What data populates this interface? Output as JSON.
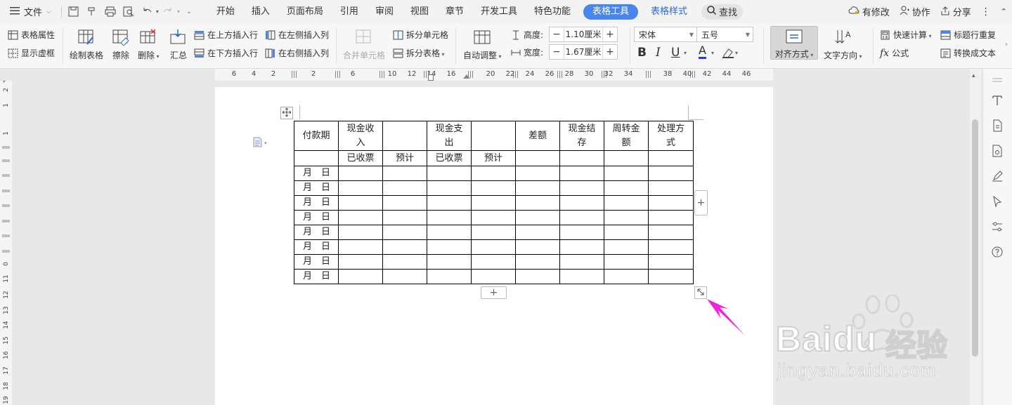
{
  "menubar": {
    "file_label": "文件",
    "tabs": [
      "开始",
      "插入",
      "页面布局",
      "引用",
      "审阅",
      "视图",
      "章节",
      "开发工具",
      "特色功能"
    ],
    "active_tab": "表格工具",
    "secondary_tab": "表格样式",
    "search_label": "查找",
    "right": {
      "modified": "有修改",
      "collab": "协作",
      "share": "分享"
    }
  },
  "ribbon": {
    "table_props": "表格属性",
    "show_grid": "显示虚框",
    "draw_table": "绘制表格",
    "erase": "擦除",
    "delete": "删除",
    "summary": "汇总",
    "insert_above": "在上方插入行",
    "insert_below": "在下方插入行",
    "insert_left": "在左侧插入列",
    "insert_right": "在右侧插入列",
    "merge_cells": "合并单元格",
    "split_cells": "拆分单元格",
    "split_table": "拆分表格",
    "auto_fit": "自动调整",
    "height_label": "高度:",
    "height_value": "1.10厘米",
    "width_label": "宽度:",
    "width_value": "1.67厘米",
    "font_name": "宋体",
    "font_size": "五号",
    "align": "对齐方式",
    "text_dir": "文字方向",
    "quick_calc": "快速计算",
    "repeat_header": "标题行重复",
    "formula": "公式",
    "to_text": "转换成文本"
  },
  "ruler": {
    "h_ticks": [
      "6",
      "4",
      "2",
      "2",
      "6",
      "10",
      "12",
      "14",
      "16",
      "20",
      "22",
      "24",
      "26",
      "28",
      "30",
      "32",
      "34",
      "38",
      "40",
      "42",
      "44",
      "46"
    ],
    "v_ticks": [
      "2",
      "1",
      "1",
      "0",
      "11",
      "12",
      "13",
      "14",
      "15",
      "16",
      "17",
      "18",
      "19"
    ]
  },
  "table": {
    "header": [
      "付款期",
      "现金收入",
      "",
      "现金支出",
      "",
      "差额",
      "现金结存",
      "周转金额",
      "处理方式"
    ],
    "subheader": [
      "",
      "已收票",
      "预计",
      "已收票",
      "预计",
      "",
      "",
      "",
      ""
    ],
    "row_label": "月　日",
    "row_count": 8,
    "col_count": 9
  },
  "controls": {
    "add": "+"
  },
  "watermark": {
    "brand": "Baidu",
    "brand_cn": "经验",
    "url": "jingyan.baidu.com"
  },
  "colors": {
    "accent": "#4a86e8",
    "arrow": "#ee22dd"
  }
}
